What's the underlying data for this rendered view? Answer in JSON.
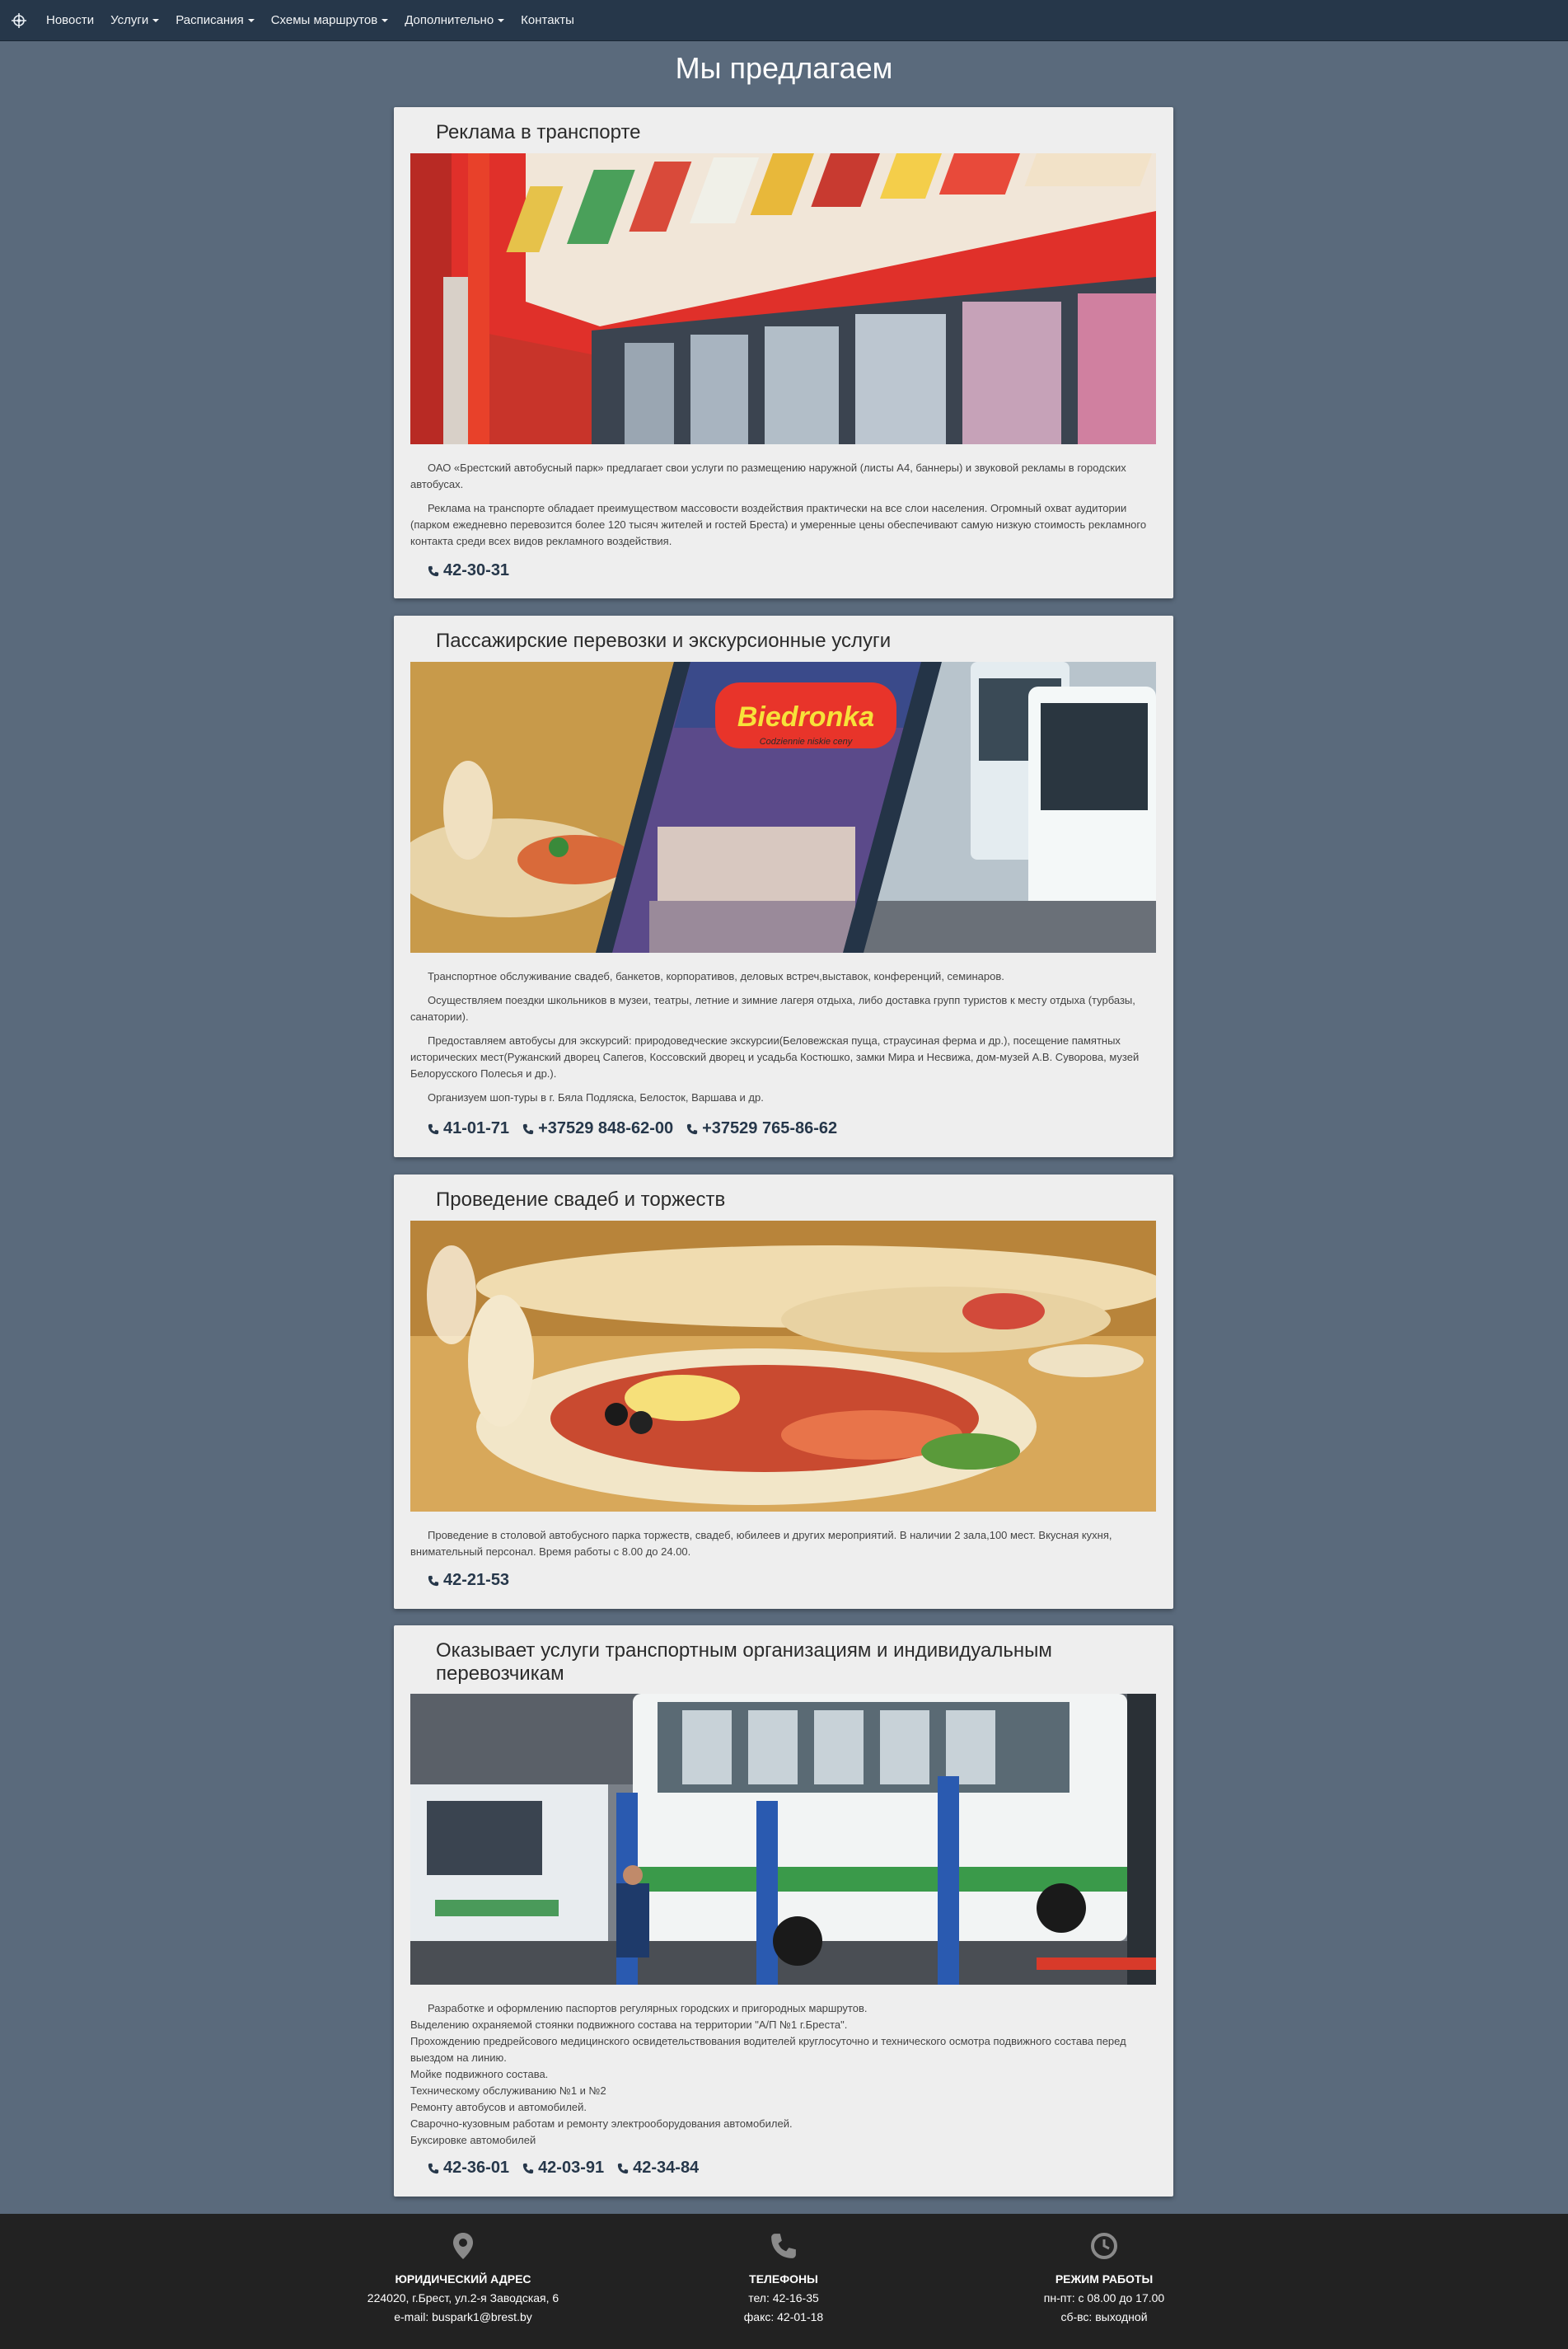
{
  "nav": {
    "items": [
      {
        "label": "Новости",
        "dropdown": false
      },
      {
        "label": "Услуги",
        "dropdown": true
      },
      {
        "label": "Расписания",
        "dropdown": true
      },
      {
        "label": "Схемы маршрутов",
        "dropdown": true
      },
      {
        "label": "Дополнительно",
        "dropdown": true
      },
      {
        "label": "Контакты",
        "dropdown": false
      }
    ]
  },
  "page": {
    "title": "Мы предлагаем"
  },
  "cards": [
    {
      "title": "Реклама в транспорте",
      "paragraphs": [
        "ОАО «Брестский автобусный парк» предлагает свои услуги по размещению наружной (листы А4, баннеры) и звуковой рекламы в городских автобусах.",
        "Реклама на транспорте обладает преимуществом массовости воздействия практически на все слои населения. Огромный охват аудитории (парком ежедневно перевозится более 120 тысяч жителей и гостей Бреста) и умеренные цены обеспечивают самую низкую стоимость рекламного контакта среди всех видов рекламного воздействия."
      ],
      "phones": [
        "42-30-31"
      ]
    },
    {
      "title": "Пассажирские перевозки и экскурсионные услуги",
      "image_text": {
        "brand": "Biedronka",
        "slogan": "Codziennie niskie ceny"
      },
      "paragraphs": [
        "Транспортное обслуживание свадеб, банкетов, корпоративов, деловых встреч,выставок, конференций, семинаров.",
        "Осуществляем поездки школьников в музеи, театры, летние и зимние лагеря отдыха, либо доставка групп туристов к месту отдыха (турбазы, санатории).",
        "Предоставляем автобусы для экскурсий: природоведческие экскурсии(Беловежская пуща, страусиная ферма и др.), посещение памятных исторических мест(Ружанский дворец Сапегов, Коссовский дворец и усадьба Костюшко, замки Мира и Несвижа, дом-музей А.В. Суворова, музей Белорусского Полесья и др.).",
        "Организуем шоп-туры в г. Бяла Подляска, Белосток, Варшава и др."
      ],
      "phones": [
        "41-01-71",
        "+37529 848-62-00",
        "+37529 765-86-62"
      ]
    },
    {
      "title": "Проведение свадеб и торжеств",
      "paragraphs": [
        "Проведение в столовой автобусного парка торжеств, свадеб, юбилеев и других мероприятий. В наличии 2 зала,100 мест. Вкусная кухня, внимательный персонал. Время работы с 8.00 до 24.00."
      ],
      "phones": [
        "42-21-53"
      ]
    },
    {
      "title": "Оказывает услуги транспортным организациям и индивидуальным перевозчикам",
      "lines": [
        "Разработке и оформлению паспортов регулярных городских и пригородных маршрутов.",
        "Выделению охраняемой стоянки подвижного состава на территории \"А/П №1 г.Бреста\".",
        "Прохождению предрейсового медицинского освидетельствования водителей круглосуточно и технического осмотра подвижного состава перед выездом на линию.",
        "Мойке подвижного состава.",
        "Техническому обслуживанию №1 и №2",
        "Ремонту автобусов и автомобилей.",
        "Сварочно-кузовным работам и ремонту электрооборудования автомобилей.",
        "Буксировке автомобилей"
      ],
      "phones": [
        "42-36-01",
        "42-03-91",
        "42-34-84"
      ]
    }
  ],
  "footer": {
    "address": {
      "heading": "ЮРИДИЧЕСКИЙ АДРЕС",
      "line1": "224020, г.Брест, ул.2-я Заводская, 6",
      "line2": "e-mail: buspark1@brest.by"
    },
    "phones": {
      "heading": "ТЕЛЕФОНЫ",
      "line1": "тел: 42-16-35",
      "line2": "факс: 42-01-18"
    },
    "hours": {
      "heading": "РЕЖИМ РАБОТЫ",
      "line1": "пн-пт: с 08.00 до 17.00",
      "line2": "сб-вс: выходной"
    }
  },
  "colors": {
    "navbar": "#26374a",
    "background": "#5a6a7c",
    "card": "#eeeeee",
    "phone": "#26374a",
    "footer": "#222222"
  },
  "icons": {
    "nav_logo": "compass-icon",
    "phone": "phone-icon",
    "address": "map-marker-icon",
    "footer_phone": "phone-icon",
    "hours": "clock-icon"
  }
}
